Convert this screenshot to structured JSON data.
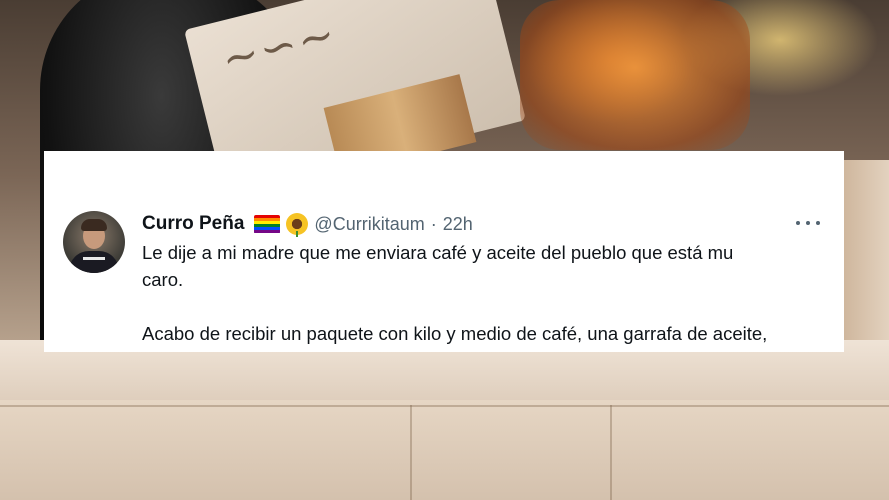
{
  "tweet": {
    "display_name": "Curro Peña",
    "badges": [
      "rainbow-flag-emoji",
      "sunflower-emoji"
    ],
    "handle": "@Currikitaum",
    "separator": "·",
    "timestamp": "22h",
    "more_icon": "more-horizontal-icon",
    "text_line_1": "Le dije a mi madre que me enviara café y aceite del pueblo que está mu",
    "text_line_2": "caro.",
    "text_line_3": "Acabo de recibir un paquete con kilo y medio de café, una garrafa de aceite,"
  },
  "colors": {
    "card_background": "#ffffff",
    "name": "#0f1419",
    "secondary": "#536471"
  }
}
